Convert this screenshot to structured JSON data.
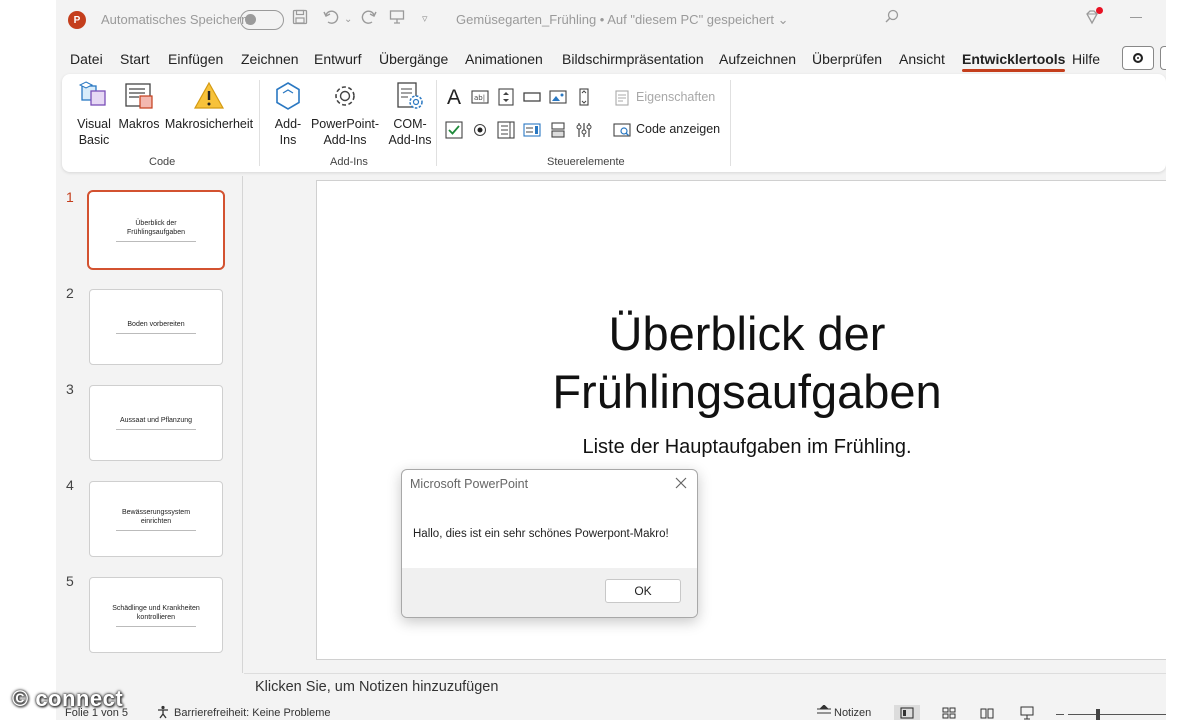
{
  "titlebar": {
    "autosave_label": "Automatisches Speichern",
    "document_title": "Gemüsegarten_Frühling • Auf \"diesem PC\" gespeichert ⌄"
  },
  "menu": {
    "tabs": [
      "Datei",
      "Start",
      "Einfügen",
      "Zeichnen",
      "Entwurf",
      "Übergänge",
      "Animationen",
      "Bildschirmpräsentation",
      "Aufzeichnen",
      "Überprüfen",
      "Ansicht",
      "Entwicklertools",
      "Hilfe"
    ],
    "active_tab": "Entwicklertools"
  },
  "ribbon": {
    "code": {
      "group_label": "Code",
      "visual_basic": "Visual Basic",
      "visual_basic_l1": "Visual",
      "visual_basic_l2": "Basic",
      "macros": "Makros",
      "macro_security": "Makrosicherheit"
    },
    "addins": {
      "group_label": "Add-Ins",
      "addins_l1": "Add-",
      "addins_l2": "Ins",
      "ppt_addins_l1": "PowerPoint-",
      "ppt_addins_l2": "Add-Ins",
      "com_addins_l1": "COM-",
      "com_addins_l2": "Add-Ins"
    },
    "controls": {
      "group_label": "Steuerelemente",
      "properties": "Eigenschaften",
      "view_code": "Code anzeigen"
    }
  },
  "slides": [
    {
      "number": "1",
      "title": "Überblick der Frühlingsaufgaben"
    },
    {
      "number": "2",
      "title": "Boden vorbereiten"
    },
    {
      "number": "3",
      "title": "Aussaat und Pflanzung"
    },
    {
      "number": "4",
      "title": "Bewässerungssystem einrichten"
    },
    {
      "number": "5",
      "title": "Schädlinge und Krankheiten kontrollieren"
    }
  ],
  "slide": {
    "title_line1": "Überblick der",
    "title_line2": "Frühlingsaufgaben",
    "subtitle": "Liste der Hauptaufgaben im Frühling."
  },
  "notes": {
    "placeholder": "Klicken Sie, um Notizen hinzuzufügen"
  },
  "statusbar": {
    "slide_counter": "Folie 1 von 5",
    "accessibility": "Barrierefreiheit: Keine Probleme",
    "notes_button": "Notizen"
  },
  "dialog": {
    "title": "Microsoft PowerPoint",
    "message": "Hallo, dies ist ein sehr schönes Powerpont-Makro!",
    "ok_label": "OK"
  },
  "watermark": "© connect"
}
